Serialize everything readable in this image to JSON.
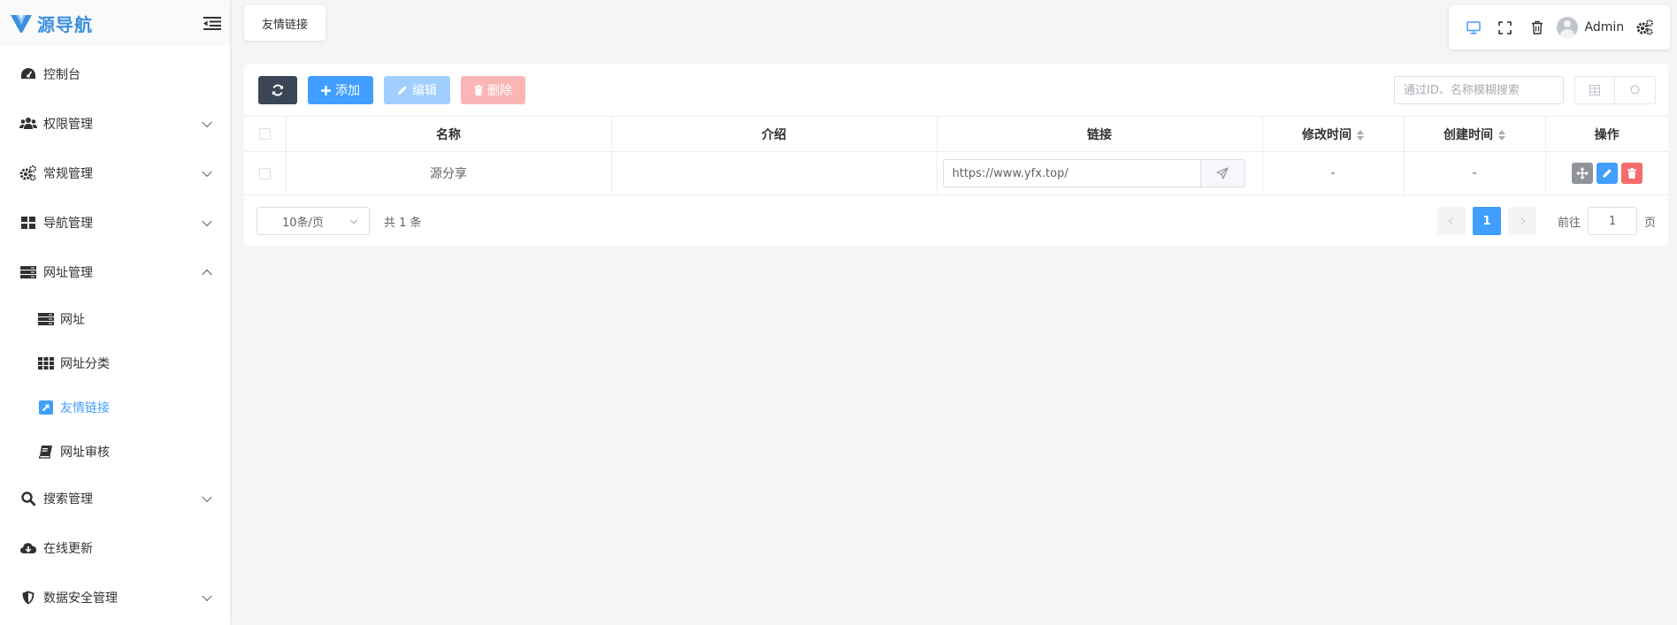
{
  "app": {
    "logo_text": "源导航"
  },
  "sidebar": {
    "items": [
      {
        "label": "控制台",
        "icon": "dashboard-icon"
      },
      {
        "label": "权限管理",
        "icon": "users-icon"
      },
      {
        "label": "常规管理",
        "icon": "cogs-icon"
      },
      {
        "label": "导航管理",
        "icon": "grid-icon"
      },
      {
        "label": "网址管理",
        "icon": "server-icon",
        "expanded": true
      },
      {
        "label": "搜索管理",
        "icon": "search-icon"
      },
      {
        "label": "在线更新",
        "icon": "cloud-download-icon"
      },
      {
        "label": "数据安全管理",
        "icon": "shield-icon"
      }
    ],
    "subitems": [
      {
        "label": "网址",
        "icon": "server-icon"
      },
      {
        "label": "网址分类",
        "icon": "th-icon"
      },
      {
        "label": "友情链接",
        "icon": "external-link-icon",
        "active": true
      },
      {
        "label": "网址审核",
        "icon": "book-icon"
      }
    ]
  },
  "tabs": {
    "current": "友情链接"
  },
  "header": {
    "username": "Admin"
  },
  "toolbar": {
    "add_label": "添加",
    "edit_label": "编辑",
    "delete_label": "删除",
    "search_placeholder": "通过ID、名称模糊搜索"
  },
  "table": {
    "columns": [
      "名称",
      "介绍",
      "链接",
      "修改时间",
      "创建时间",
      "操作"
    ],
    "rows": [
      {
        "name": "源分享",
        "intro": "",
        "link": "https://www.yfx.top/",
        "modified": "-",
        "created": "-"
      }
    ]
  },
  "pagination": {
    "page_size": "10条/页",
    "total": "共 1 条",
    "current_page": "1",
    "goto_label": "前往",
    "goto_value": "1",
    "page_label": "页"
  },
  "colors": {
    "primary": "#409eff",
    "danger": "#f56c6c",
    "dark": "#3a4556",
    "logo": "#3b8fe0"
  }
}
